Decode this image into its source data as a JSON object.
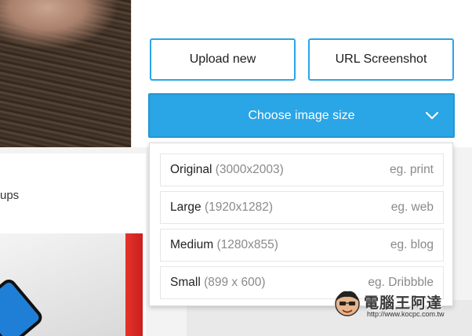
{
  "background": {
    "partial_text": "ups"
  },
  "buttons": {
    "upload_label": "Upload new",
    "url_label": "URL Screenshot"
  },
  "dropdown": {
    "label": "Choose image size",
    "options": [
      {
        "name": "Original",
        "dims": "(3000x2003)",
        "example": "eg. print"
      },
      {
        "name": "Large",
        "dims": "(1920x1282)",
        "example": "eg. web"
      },
      {
        "name": "Medium",
        "dims": "(1280x855)",
        "example": "eg. blog"
      },
      {
        "name": "Small",
        "dims": "(899 x 600)",
        "example": "eg. Dribbble"
      }
    ]
  },
  "watermark": {
    "title": "電腦王阿達",
    "url": "http://www.kocpc.com.tw"
  },
  "colors": {
    "accent": "#2aa5e6",
    "text": "#222222",
    "muted": "#8a8a8a"
  }
}
